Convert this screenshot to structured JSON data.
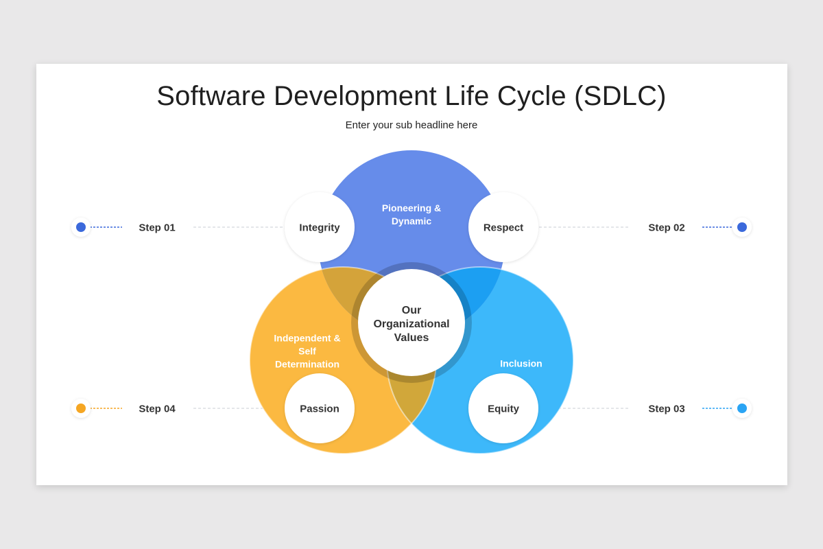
{
  "slide": {
    "title": "Software Development Life Cycle (SDLC)",
    "subtitle": "Enter your sub headline here"
  },
  "colors": {
    "blue_circle": "#668cea",
    "yellow_circle": "#fbb941",
    "light_blue_circle": "#3db8fa",
    "step01_dot": "#3b69db",
    "step02_dot": "#3b69db",
    "step03_dot": "#2aa4f4",
    "step04_dot": "#f5a623"
  },
  "center": {
    "line1": "Our",
    "line2": "Organizational",
    "line3": "Values"
  },
  "petals": {
    "top": {
      "line1": "Pioneering &",
      "line2": "Dynamic"
    },
    "left": {
      "line1": "Independent &",
      "line2": "Self",
      "line3": "Determination"
    },
    "right": {
      "line1": "Inclusion"
    }
  },
  "bubbles": {
    "integrity": "Integrity",
    "respect": "Respect",
    "passion": "Passion",
    "equity": "Equity"
  },
  "steps": {
    "step01": "Step 01",
    "step02": "Step 02",
    "step03": "Step 03",
    "step04": "Step 04"
  }
}
